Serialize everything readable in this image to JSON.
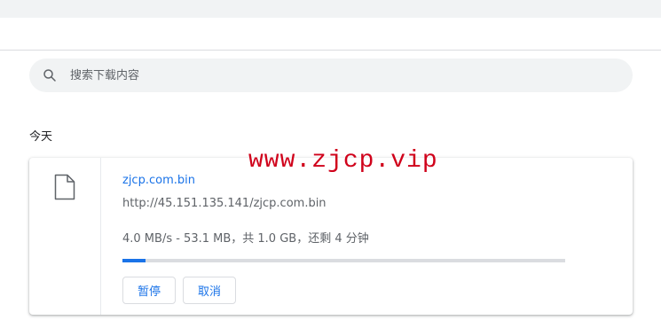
{
  "search": {
    "placeholder": "搜索下载内容",
    "icon": "search-icon"
  },
  "section": {
    "date_label": "今天"
  },
  "download": {
    "file_icon": "file-icon",
    "file_name": "zjcp.com.bin",
    "url": "http://45.151.135.141/zjcp.com.bin",
    "status": "4.0 MB/s - 53.1 MB，共 1.0 GB，还剩 4 分钟",
    "progress_fraction": 0.0531,
    "buttons": {
      "pause_label": "暂停",
      "cancel_label": "取消"
    }
  },
  "watermark": {
    "text": "www.zjcp.vip"
  },
  "colors": {
    "accent": "#1a73e8",
    "watermark": "#d0021b",
    "search_bg": "#f1f3f4",
    "secondary_text": "#5f6368"
  }
}
